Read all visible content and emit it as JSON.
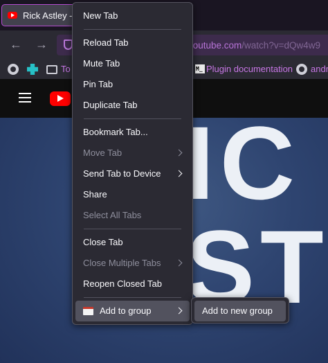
{
  "tab": {
    "title": "Rick Astley - N"
  },
  "urlbar": {
    "url_main": "youtube.com",
    "url_rest": "/watch?v=dQw4w9"
  },
  "bookmarks": [
    {
      "label": "To"
    },
    {
      "label": "Plugin documentation"
    },
    {
      "label": "andr"
    }
  ],
  "video": {
    "line1": "IC",
    "line2": "ST"
  },
  "context_menu": {
    "new_tab": "New Tab",
    "reload_tab": "Reload Tab",
    "mute_tab": "Mute Tab",
    "pin_tab": "Pin Tab",
    "duplicate_tab": "Duplicate Tab",
    "bookmark_tab": "Bookmark Tab...",
    "move_tab": "Move Tab",
    "send_tab": "Send Tab to Device",
    "share": "Share",
    "select_all_tabs": "Select All Tabs",
    "close_tab": "Close Tab",
    "close_multiple_tabs": "Close Multiple Tabs",
    "reopen_closed_tab": "Reopen Closed Tab",
    "add_to_group": "Add to group"
  },
  "submenu": {
    "add_to_new_group": "Add to new group"
  },
  "colors": {
    "accent": "#b54bd1",
    "menu_bg": "#2b2a33",
    "hover_bg": "#52525e",
    "disabled_text": "#8f8f9d"
  }
}
